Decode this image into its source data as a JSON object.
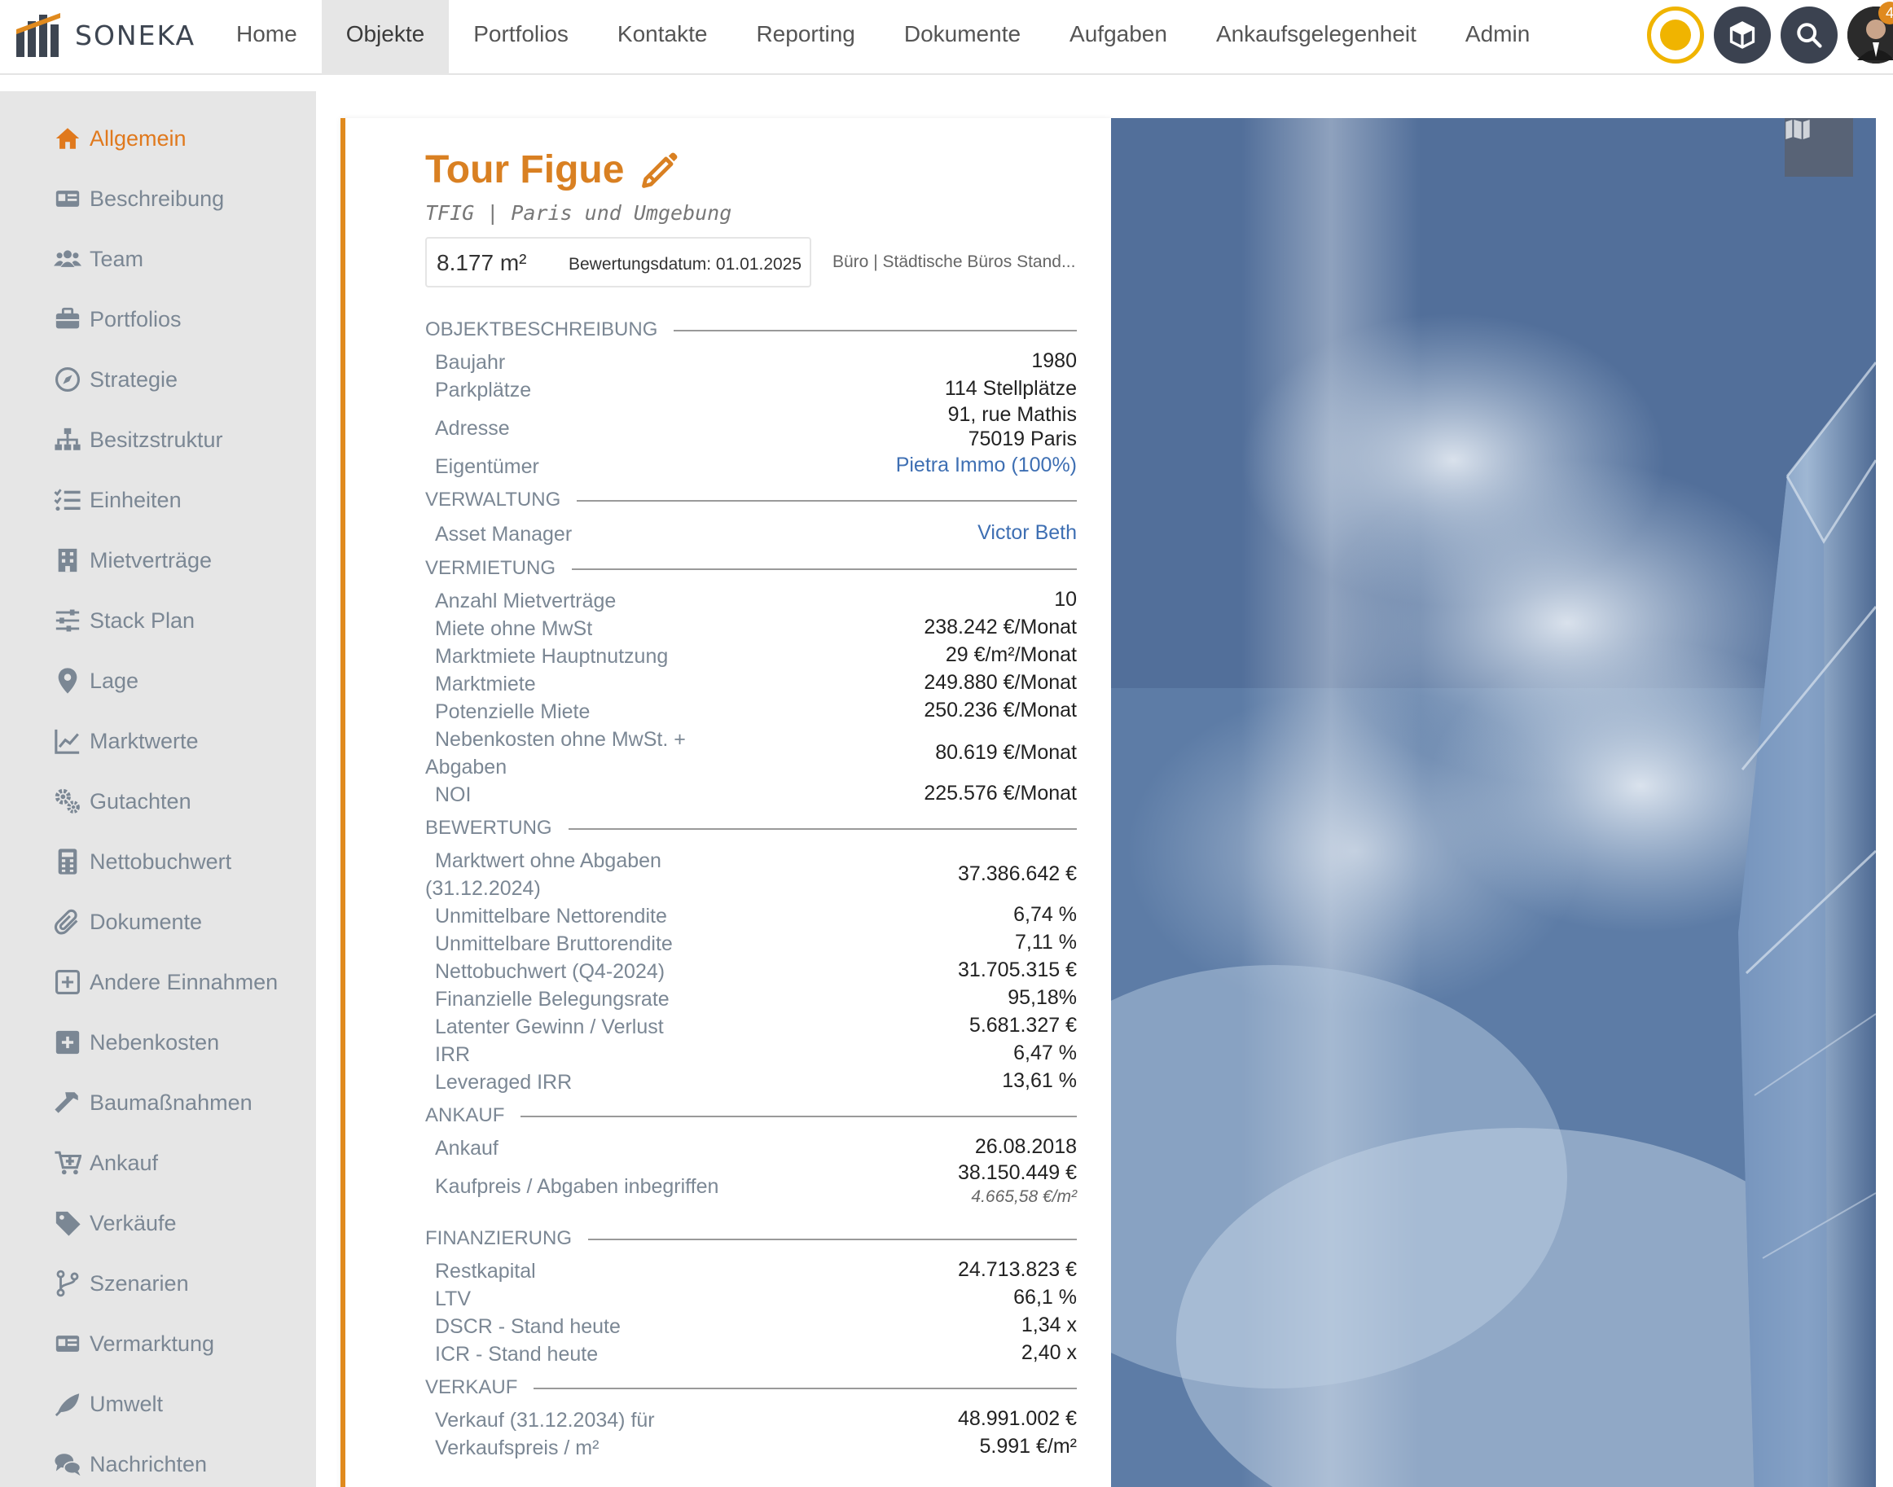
{
  "app": {
    "brand": "SONEKA"
  },
  "nav": [
    {
      "label": "Home"
    },
    {
      "label": "Objekte"
    },
    {
      "label": "Portfolios"
    },
    {
      "label": "Kontakte"
    },
    {
      "label": "Reporting"
    },
    {
      "label": "Dokumente"
    },
    {
      "label": "Aufgaben"
    },
    {
      "label": "Ankaufsgelegenheit"
    },
    {
      "label": "Admin"
    }
  ],
  "notifications": {
    "count": "4"
  },
  "sidebar": [
    {
      "label": "Allgemein",
      "icon": "home-icon"
    },
    {
      "label": "Beschreibung",
      "icon": "id-card-icon"
    },
    {
      "label": "Team",
      "icon": "users-icon"
    },
    {
      "label": "Portfolios",
      "icon": "briefcase-icon"
    },
    {
      "label": "Strategie",
      "icon": "compass-icon"
    },
    {
      "label": "Besitzstruktur",
      "icon": "sitemap-icon"
    },
    {
      "label": "Einheiten",
      "icon": "checklist-icon"
    },
    {
      "label": "Mietverträge",
      "icon": "building-icon"
    },
    {
      "label": "Stack Plan",
      "icon": "sliders-icon"
    },
    {
      "label": "Lage",
      "icon": "map-pin-icon"
    },
    {
      "label": "Marktwerte",
      "icon": "line-chart-icon"
    },
    {
      "label": "Gutachten",
      "icon": "cogs-icon"
    },
    {
      "label": "Nettobuchwert",
      "icon": "calculator-icon"
    },
    {
      "label": "Dokumente",
      "icon": "paperclip-icon"
    },
    {
      "label": "Andere Einnahmen",
      "icon": "plus-square-outline-icon"
    },
    {
      "label": "Nebenkosten",
      "icon": "plus-square-icon"
    },
    {
      "label": "Baumaßnahmen",
      "icon": "hammer-icon"
    },
    {
      "label": "Ankauf",
      "icon": "cart-plus-icon"
    },
    {
      "label": "Verkäufe",
      "icon": "tag-icon"
    },
    {
      "label": "Szenarien",
      "icon": "branch-icon"
    },
    {
      "label": "Vermarktung",
      "icon": "id-card-icon"
    },
    {
      "label": "Umwelt",
      "icon": "leaf-icon"
    },
    {
      "label": "Nachrichten",
      "icon": "comments-icon"
    }
  ],
  "property": {
    "title": "Tour Figue",
    "subtitle": "TFIG | Paris und Umgebung",
    "area": "8.177 m²",
    "valuation_date": "Bewertungsdatum: 01.01.2025",
    "usage": "Büro | Städtische Büros Stand..."
  },
  "sections": {
    "objekt": "OBJEKTBESCHREIBUNG",
    "verwaltung": "VERWALTUNG",
    "vermietung": "VERMIETUNG",
    "bewertung": "BEWERTUNG",
    "ankauf": "ANKAUF",
    "finanzierung": "FINANZIERUNG",
    "verkauf": "VERKAUF"
  },
  "objekt": {
    "baujahr_label": "Baujahr",
    "baujahr": "1980",
    "parkplaetze_label": "Parkplätze",
    "parkplaetze": "114 Stellplätze",
    "adresse_label": "Adresse",
    "adresse_line1": "91, rue Mathis",
    "adresse_line2": "75019 Paris",
    "eigentuemer_label": "Eigentümer",
    "eigentuemer": "Pietra Immo (100%)"
  },
  "verwaltung": {
    "am_label": "Asset Manager",
    "am": "Victor Beth"
  },
  "vermietung": {
    "anzahl_label": "Anzahl Mietverträge",
    "anzahl": "10",
    "miete_label": "Miete ohne MwSt",
    "miete": "238.242 €/Monat",
    "mm_haupt_label": "Marktmiete Hauptnutzung",
    "mm_haupt": "29 €/m²/Monat",
    "mm_label": "Marktmiete",
    "mm": "249.880 €/Monat",
    "pot_label": "Potenzielle Miete",
    "pot": "250.236 €/Monat",
    "nk_label": "Nebenkosten ohne MwSt. + Abgaben",
    "nk": "80.619 €/Monat",
    "noi_label": "NOI",
    "noi": "225.576 €/Monat"
  },
  "bewertung": {
    "mw_label": "Marktwert ohne Abgaben (31.12.2024)",
    "mw": "37.386.642 €",
    "netto_label": "Unmittelbare Nettorendite",
    "netto": "6,74 %",
    "brutto_label": "Unmittelbare Bruttorendite",
    "brutto": "7,11 %",
    "nbw_label": "Nettobuchwert (Q4-2024)",
    "nbw": "31.705.315 €",
    "beleg_label": "Finanzielle Belegungsrate",
    "beleg": "95,18%",
    "latent_label": "Latenter Gewinn / Verlust",
    "latent": "5.681.327 €",
    "irr_label": "IRR",
    "irr": "6,47 %",
    "lirr_label": "Leveraged IRR",
    "lirr": "13,61 %"
  },
  "ankauf": {
    "ankauf_label": "Ankauf",
    "ankauf": "26.08.2018",
    "kp_label": "Kaufpreis / Abgaben inbegriffen",
    "kp": "38.150.449 €",
    "kp_sqm": "4.665,58 €/m²"
  },
  "finanzierung": {
    "rest_label": "Restkapital",
    "rest": "24.713.823 €",
    "ltv_label": "LTV",
    "ltv": "66,1 %",
    "dscr_label": "DSCR - Stand heute",
    "dscr": "1,34 x",
    "icr_label": "ICR - Stand heute",
    "icr": "2,40 x"
  },
  "verkauf": {
    "vk_label": "Verkauf (31.12.2034) für",
    "vk": "48.991.002 €",
    "vkp_label": "Verkaufspreis / m²",
    "vkp": "5.991 €/m²"
  },
  "colors": {
    "accent": "#e08a1e",
    "link": "#3e6fb3",
    "sidebar_bg": "#e6e6e6",
    "muted": "#7b8794"
  }
}
